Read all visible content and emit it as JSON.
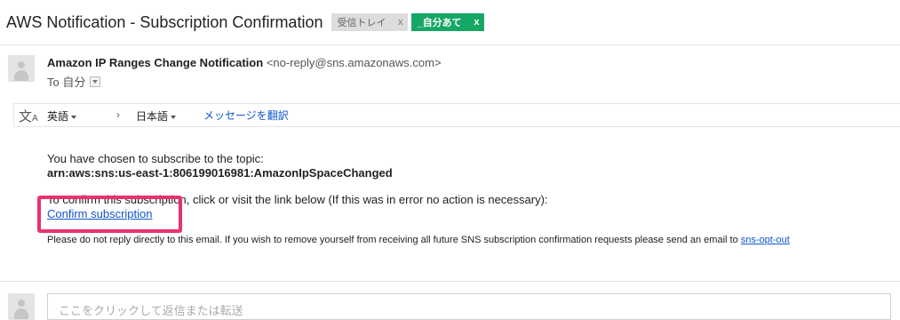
{
  "subject": "AWS Notification - Subscription Confirmation",
  "labels": [
    {
      "text": "受信トレイ",
      "close": "x"
    },
    {
      "text": "_自分あて",
      "close": "x"
    }
  ],
  "sender": {
    "name": "Amazon IP Ranges Change Notification",
    "email": "<no-reply@sns.amazonaws.com>",
    "to": "To 自分"
  },
  "translate": {
    "icon": "文",
    "icon_sub": "A",
    "source_lang": "英語",
    "arrow": "›",
    "target_lang": "日本語",
    "action": "メッセージを翻訳"
  },
  "body": {
    "line1": "You have chosen to subscribe to the topic:",
    "topic_arn": "arn:aws:sns:us-east-1:806199016981:AmazonIpSpaceChanged",
    "line2": "To confirm this subscription, click or visit the link below (If this was in error no action is necessary):",
    "confirm_link": "Confirm subscription",
    "footer": "Please do not reply directly to this email. If you wish to remove yourself from receiving all future SNS subscription confirmation requests please send an email to",
    "opt_out": "sns-opt-out"
  },
  "reply_placeholder": "ここをクリックして返信または転送"
}
